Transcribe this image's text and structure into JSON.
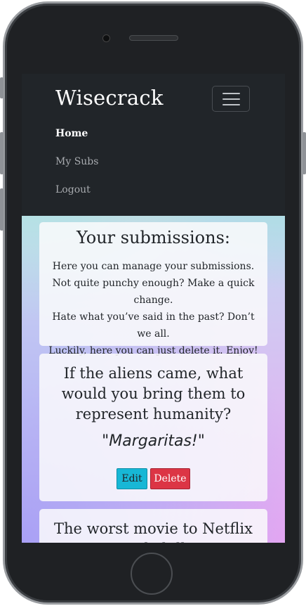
{
  "navbar": {
    "brand": "Wisecrack",
    "toggler_icon": "hamburger-menu-icon",
    "links": [
      {
        "label": "Home",
        "active": true
      },
      {
        "label": "My Subs",
        "active": false
      },
      {
        "label": "Logout",
        "active": false
      }
    ]
  },
  "intro": {
    "title": "Your submissions:",
    "lines": [
      "Here you can manage your submissions.",
      "Not quite punchy enough? Make a quick",
      "change.",
      "Hate what you’ve said in the past? Don’t we all.",
      "Luckily, here you can just delete it. Enjoy!"
    ]
  },
  "submissions": [
    {
      "prompt": "If the aliens came, what would you bring them to represent humanity?",
      "answer": "\"Margaritas!\"",
      "edit_label": "Edit",
      "delete_label": "Delete"
    },
    {
      "prompt": "The worst movie to Netflix and chill"
    }
  ],
  "colors": {
    "navbar_bg": "#212529",
    "edit_button": "#17b7d6",
    "delete_button": "#dc3545"
  }
}
